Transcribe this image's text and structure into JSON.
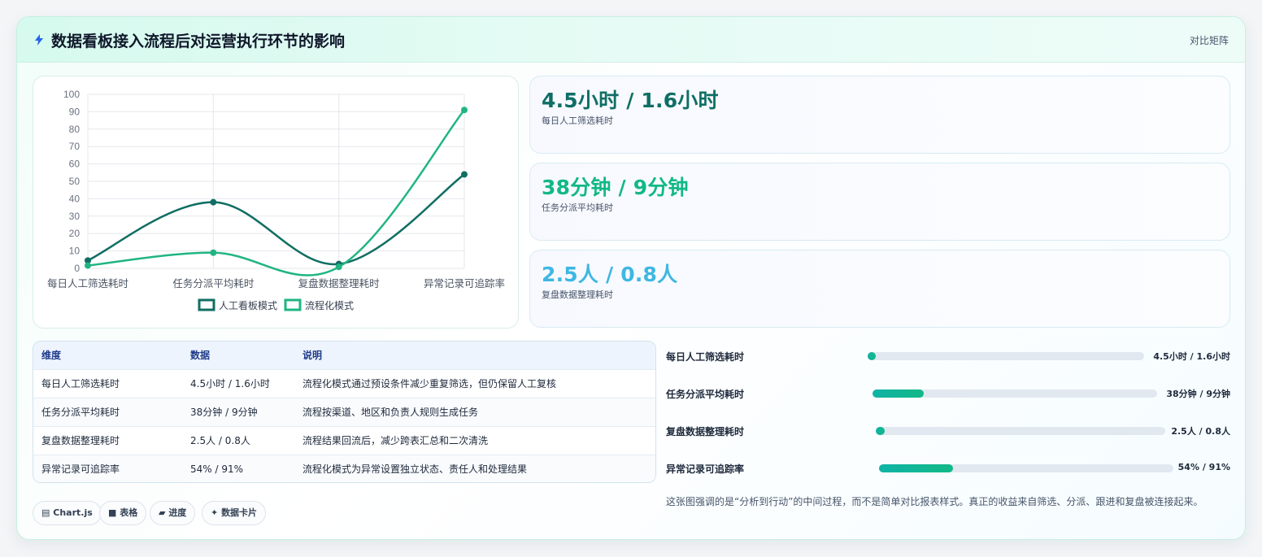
{
  "header": {
    "title": "数据看板接入流程后对运营执行环节的影响",
    "link": "对比矩阵"
  },
  "colors": {
    "manual": "#116e63",
    "process": "#20b582",
    "kpi1": "#0f6e65",
    "kpi2": "#12b886",
    "kpi3": "#3eb7e3"
  },
  "kpis": [
    {
      "value": "4.5小时 / 1.6小时",
      "label": "每日人工筛选耗时"
    },
    {
      "value": "38分钟 / 9分钟",
      "label": "任务分派平均耗时"
    },
    {
      "value": "2.5人 / 0.8人",
      "label": "复盘数据整理耗时"
    }
  ],
  "chart_data": {
    "type": "line",
    "categories": [
      "每日人工筛选耗时",
      "任务分派平均耗时",
      "复盘数据整理耗时",
      "异常记录可追踪率"
    ],
    "series": [
      {
        "name": "人工看板模式",
        "values": [
          4.5,
          38,
          2.5,
          54
        ],
        "color": "#116e63"
      },
      {
        "name": "流程化模式",
        "values": [
          1.6,
          9,
          0.8,
          91
        ],
        "color": "#20b582"
      }
    ],
    "yticks": [
      "0",
      "10",
      "20",
      "30",
      "40",
      "50",
      "60",
      "70",
      "80",
      "90",
      "100"
    ],
    "ylim": [
      0,
      100
    ],
    "grid": true,
    "legend": "bottom"
  },
  "table": {
    "headers": [
      "维度",
      "数据",
      "说明"
    ],
    "rows": [
      [
        "每日人工筛选耗时",
        "4.5小时 / 1.6小时",
        "流程化模式通过预设条件减少重复筛选，但仍保留人工复核"
      ],
      [
        "任务分派平均耗时",
        "38分钟 / 9分钟",
        "流程按渠道、地区和负责人规则生成任务"
      ],
      [
        "复盘数据整理耗时",
        "2.5人 / 0.8人",
        "流程结果回流后，减少跨表汇总和二次清洗"
      ],
      [
        "异常记录可追踪率",
        "54% / 91%",
        "流程化模式为异常设置独立状态、责任人和处理结果"
      ]
    ]
  },
  "chips": [
    "Chart.js",
    "表格",
    "进度",
    "数据卡片"
  ],
  "progress": [
    {
      "label": "每日人工筛选耗时",
      "value": "4.5小时 / 1.6小时",
      "fill": 0.02
    },
    {
      "label": "任务分派平均耗时",
      "value": "38分钟 / 9分钟",
      "fill": 0.18
    },
    {
      "label": "复盘数据整理耗时",
      "value": "2.5人 / 0.8人",
      "fill": 0.02
    },
    {
      "label": "异常记录可追踪率",
      "value": "54% / 91%",
      "fill": 0.25
    }
  ],
  "note": "这张图强调的是“分析到行动”的中间过程，而不是简单对比报表样式。真正的收益来自筛选、分派、跟进和复盘被连接起来。"
}
